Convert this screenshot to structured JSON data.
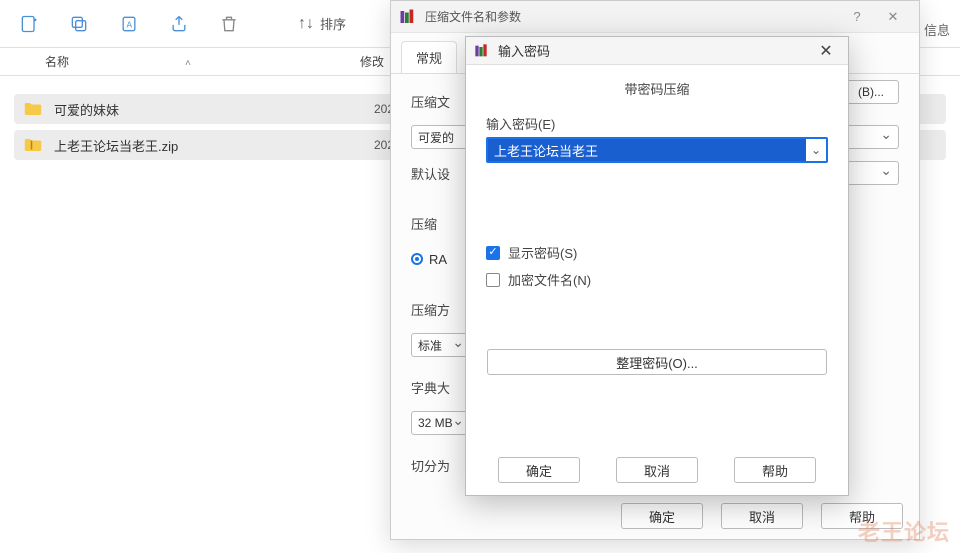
{
  "toolbar": {
    "sort_label": "排序"
  },
  "columns": {
    "name": "名称",
    "modified": "修改"
  },
  "files": [
    {
      "name": "可爱的妹妹",
      "modified": "202",
      "type": "folder"
    },
    {
      "name": "上老王论坛当老王.zip",
      "modified": "202",
      "type": "zip"
    }
  ],
  "parent_dialog": {
    "title": "压缩文件名和参数",
    "tab_general": "常规",
    "field_archive": "压缩文",
    "archive_value": "可爱的",
    "field_default": "默认设",
    "field_format": "压缩",
    "format_ra": "RA",
    "field_method": "压缩方",
    "method_value": "标准",
    "field_dict": "字典大",
    "dict_value": "32 MB",
    "field_split": "切分为",
    "browse_label": "(B)...",
    "ok": "确定",
    "cancel": "取消",
    "help": "帮助"
  },
  "password_dialog": {
    "title": "输入密码",
    "subtitle": "带密码压缩",
    "field_password": "输入密码(E)",
    "password_value": "上老王论坛当老王",
    "show_password": "显示密码(S)",
    "encrypt_names": "加密文件名(N)",
    "organize": "整理密码(O)...",
    "ok": "确定",
    "cancel": "取消",
    "help": "帮助"
  },
  "right_edge": "信息",
  "watermark": "老王论坛"
}
